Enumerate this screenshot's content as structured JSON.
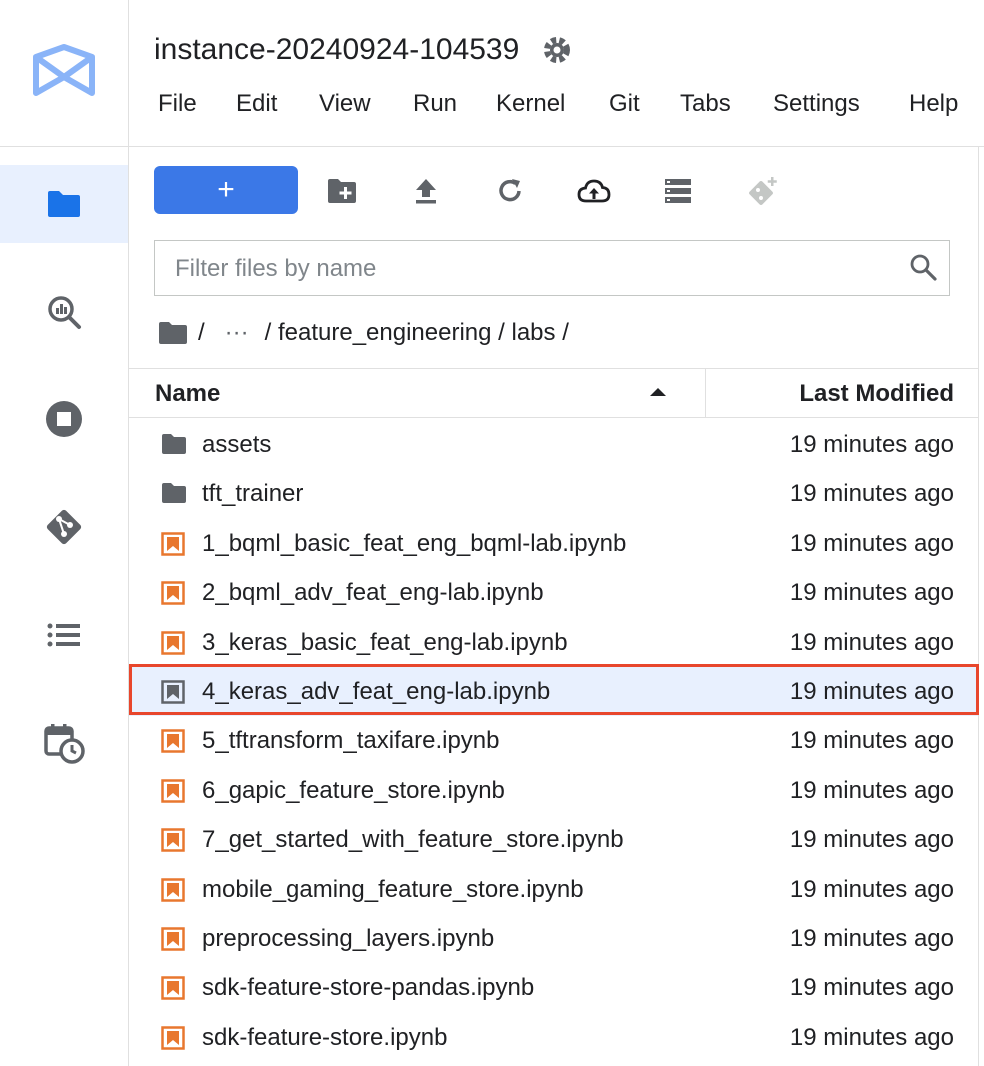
{
  "app": {
    "title": "instance-20240924-104539"
  },
  "menu": [
    "File",
    "Edit",
    "View",
    "Run",
    "Kernel",
    "Git",
    "Tabs",
    "Settings",
    "Help"
  ],
  "sidebar": {
    "items": [
      {
        "icon": "folder-icon",
        "active": true
      },
      {
        "icon": "bigquery-search-icon",
        "active": false
      },
      {
        "icon": "stop-circle-icon",
        "active": false
      },
      {
        "icon": "git-icon",
        "active": false
      },
      {
        "icon": "list-icon",
        "active": false
      },
      {
        "icon": "calendar-clock-icon",
        "active": false
      }
    ]
  },
  "toolbar": {
    "new_label": "+",
    "icons": [
      "new-folder-icon",
      "upload-icon",
      "refresh-icon",
      "cloud-upload-icon",
      "storage-icon",
      "git-clone-icon"
    ]
  },
  "search": {
    "placeholder": "Filter files by name",
    "value": ""
  },
  "breadcrumb": {
    "sep1": "/",
    "ellipsis": "···",
    "path": "/ feature_engineering / labs /"
  },
  "table": {
    "col_name": "Name",
    "col_modified": "Last Modified",
    "rows": [
      {
        "name": "assets",
        "modified": "19 minutes ago",
        "type": "folder"
      },
      {
        "name": "tft_trainer",
        "modified": "19 minutes ago",
        "type": "folder"
      },
      {
        "name": "1_bqml_basic_feat_eng_bqml-lab.ipynb",
        "modified": "19 minutes ago",
        "type": "notebook"
      },
      {
        "name": "2_bqml_adv_feat_eng-lab.ipynb",
        "modified": "19 minutes ago",
        "type": "notebook"
      },
      {
        "name": "3_keras_basic_feat_eng-lab.ipynb",
        "modified": "19 minutes ago",
        "type": "notebook"
      },
      {
        "name": "4_keras_adv_feat_eng-lab.ipynb",
        "modified": "19 minutes ago",
        "type": "notebook-selected"
      },
      {
        "name": "5_tftransform_taxifare.ipynb",
        "modified": "19 minutes ago",
        "type": "notebook"
      },
      {
        "name": "6_gapic_feature_store.ipynb",
        "modified": "19 minutes ago",
        "type": "notebook"
      },
      {
        "name": "7_get_started_with_feature_store.ipynb",
        "modified": "19 minutes ago",
        "type": "notebook"
      },
      {
        "name": "mobile_gaming_feature_store.ipynb",
        "modified": "19 minutes ago",
        "type": "notebook"
      },
      {
        "name": "preprocessing_layers.ipynb",
        "modified": "19 minutes ago",
        "type": "notebook"
      },
      {
        "name": "sdk-feature-store-pandas.ipynb",
        "modified": "19 minutes ago",
        "type": "notebook"
      },
      {
        "name": "sdk-feature-store.ipynb",
        "modified": "19 minutes ago",
        "type": "notebook"
      }
    ]
  },
  "colors": {
    "accent": "#3b78e7",
    "selected_bg": "#e8f0fe",
    "highlight_border": "#e8462c",
    "notebook_icon": "#e8772e",
    "icon_gray": "#5f6368"
  }
}
